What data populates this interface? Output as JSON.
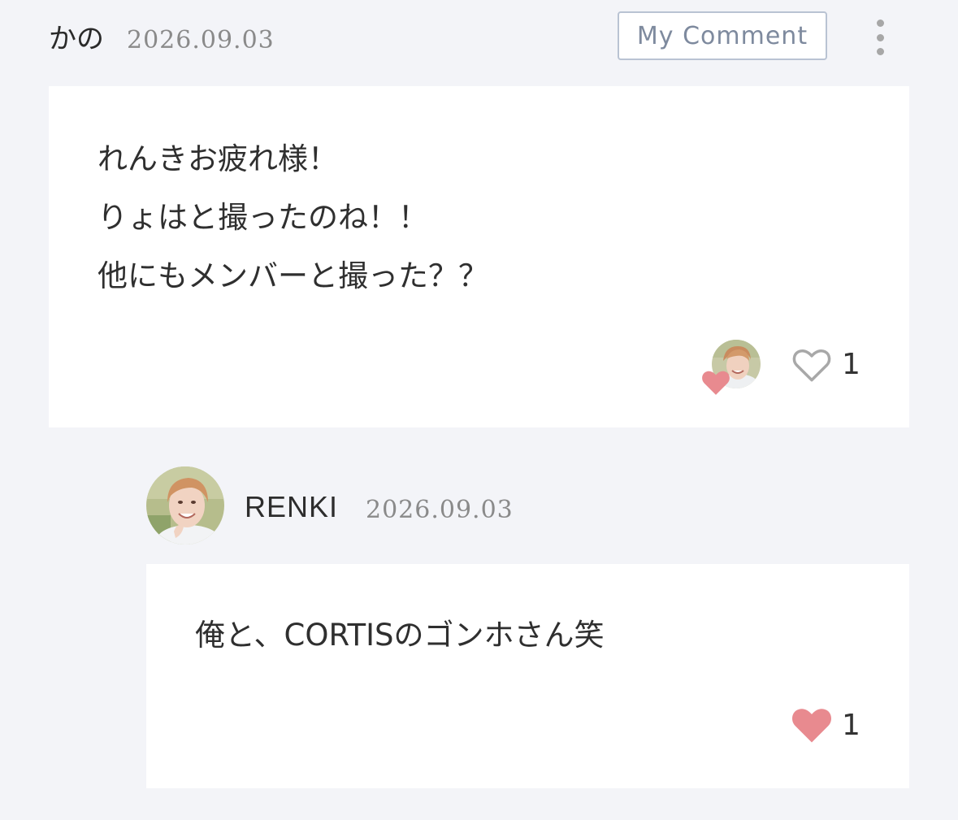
{
  "comment": {
    "author": "かの",
    "date": "2026.09.03",
    "my_comment_label": "My Comment",
    "lines": [
      "れんきお疲れ様！",
      "りょはと撮ったのね！！",
      "他にもメンバーと撮った？？"
    ],
    "like_count": "1"
  },
  "reply": {
    "author": "RENKI",
    "date": "2026.09.03",
    "text": "俺と、CORTISのゴンホさん笑",
    "like_count": "1"
  },
  "icons": {
    "menu": "more-vertical-icon",
    "like_empty": "heart-outline-icon",
    "like_filled": "heart-filled-icon"
  },
  "colors": {
    "background": "#f3f4f8",
    "card": "#ffffff",
    "heart": "#e88a8f",
    "heart_outline": "#a8a8a8",
    "my_comment_border": "#b9c3d3",
    "my_comment_text": "#7e8a9e"
  }
}
